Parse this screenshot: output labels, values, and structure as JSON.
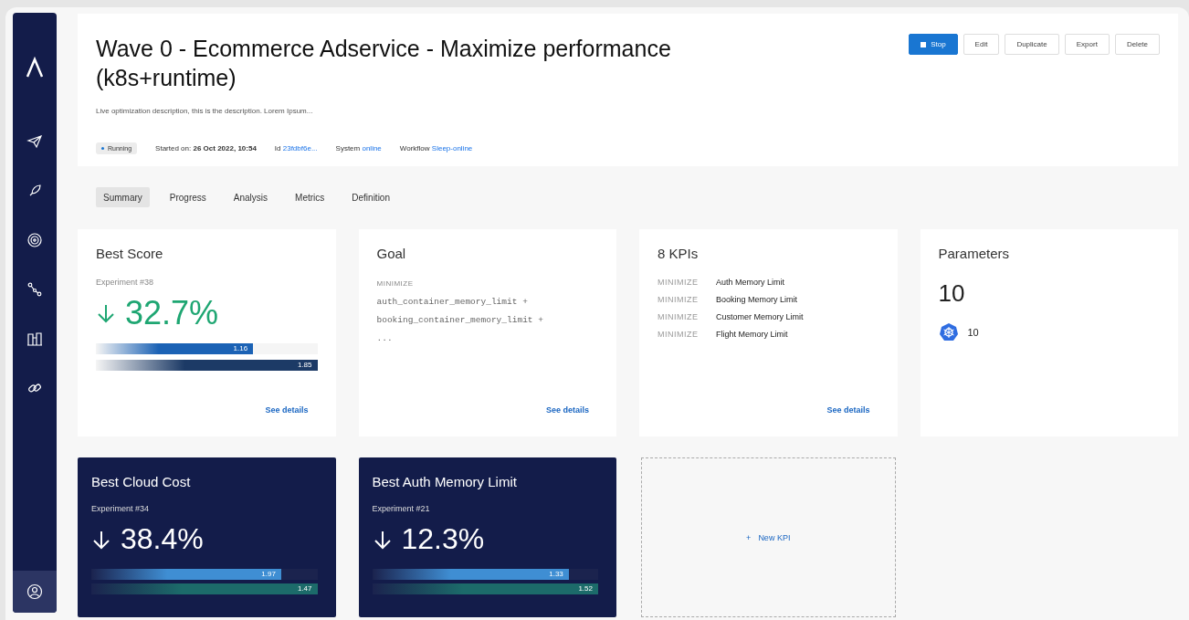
{
  "header": {
    "title": "Wave 0 - Ecommerce Adservice - Maximize performance (k8s+runtime)",
    "description": "Live optimization description, this is the description. Lorem Ipsum...",
    "status": "Running",
    "meta": [
      {
        "label": "Started on:",
        "value": "26 Oct 2022, 10:54",
        "kind": "text"
      },
      {
        "label": "Id",
        "value": "23fdbf6e...",
        "kind": "link"
      },
      {
        "label": "System",
        "value": "online",
        "kind": "link"
      },
      {
        "label": "Workflow",
        "value": "Sleep-online",
        "kind": "link"
      }
    ]
  },
  "actions": [
    {
      "label": "Stop",
      "kind": "primary"
    },
    {
      "label": "Edit",
      "kind": "default"
    },
    {
      "label": "Duplicate",
      "kind": "default"
    },
    {
      "label": "Export",
      "kind": "default"
    },
    {
      "label": "Delete",
      "kind": "default"
    }
  ],
  "tabs": [
    {
      "label": "Summary",
      "selected": true
    },
    {
      "label": "Progress",
      "selected": false
    },
    {
      "label": "Analysis",
      "selected": false
    },
    {
      "label": "Metrics",
      "selected": false
    },
    {
      "label": "Definition",
      "selected": false
    }
  ],
  "cards": [
    {
      "kind": "score",
      "highlighted": false,
      "title": "Best Score",
      "subtitle": "Experiment #38",
      "value": "32.7%",
      "bars": [
        {
          "label": "1.16",
          "level": 0.71
        },
        {
          "label": "1.85",
          "level": 1
        }
      ],
      "link": "See details"
    },
    {
      "kind": "goal",
      "title": "Goal",
      "direction": "MINIMIZE",
      "formula_lines": [
        "auth_container_memory_limit +",
        "booking_container_memory_limit +",
        "..."
      ],
      "link": "See details"
    },
    {
      "kind": "kpis",
      "title": "8 KPIs",
      "kpis": [
        {
          "direction": "MINIMIZE",
          "name": "Auth Memory Limit"
        },
        {
          "direction": "MINIMIZE",
          "name": "Booking Memory Limit"
        },
        {
          "direction": "MINIMIZE",
          "name": "Customer Memory Limit"
        },
        {
          "direction": "MINIMIZE",
          "name": "Flight Memory Limit"
        }
      ],
      "link": "See details"
    },
    {
      "kind": "parameters",
      "title": "Parameters",
      "count": "10",
      "groups": [
        {
          "count": "10"
        }
      ]
    },
    {
      "kind": "score",
      "highlighted": true,
      "title": "Best Cloud Cost",
      "subtitle": "Experiment #34",
      "value": "38.4%",
      "bars": [
        {
          "label": "1.97",
          "level": 0.84
        },
        {
          "label": "1.47",
          "level": 1
        }
      ]
    },
    {
      "kind": "score",
      "highlighted": true,
      "title": "Best Auth Memory Limit",
      "subtitle": "Experiment #21",
      "value": "12.3%",
      "bars": [
        {
          "label": "1.33",
          "level": 0.87
        },
        {
          "label": "1.52",
          "level": 1
        }
      ]
    },
    {
      "kind": "new",
      "icon": "+",
      "label": "New KPI"
    }
  ]
}
